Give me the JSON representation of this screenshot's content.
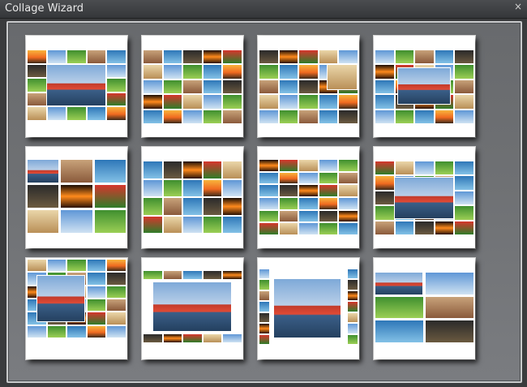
{
  "window": {
    "title": "Collage Wizard",
    "close_glyph": "×"
  },
  "layouts": [
    {
      "id": "layout-1"
    },
    {
      "id": "layout-2"
    },
    {
      "id": "layout-3"
    },
    {
      "id": "layout-4"
    },
    {
      "id": "layout-5"
    },
    {
      "id": "layout-6"
    },
    {
      "id": "layout-7"
    },
    {
      "id": "layout-8"
    },
    {
      "id": "layout-9"
    },
    {
      "id": "layout-10"
    },
    {
      "id": "layout-11"
    },
    {
      "id": "layout-12"
    }
  ],
  "palette": {
    "ship": "linear-gradient(#7ea9d8 0%,#b9cfe8 45%,#c23b2b 46%,#e04a35 60%,#3b5f88 62%,#24405f 100%)",
    "sunset": "linear-gradient(#f8b43d 0%,#f06a20 55%,#3b2a1a 100%)",
    "sky": "linear-gradient(#5f97d6,#cfe2f2)",
    "green": "linear-gradient(#3f8f2f,#9bcf55)",
    "rock": "linear-gradient(#c8a27a,#8a5a3b)",
    "sea": "linear-gradient(#2e77b8,#83c1e6)",
    "dark": "linear-gradient(#2a2a2a,#6b5a40)",
    "fire": "linear-gradient(#1a0d05,#ff8a1c,#2a1205)",
    "flower": "linear-gradient(#d6362d,#2f7d2a)",
    "sand": "linear-gradient(#ead6a9,#b98f57)"
  }
}
